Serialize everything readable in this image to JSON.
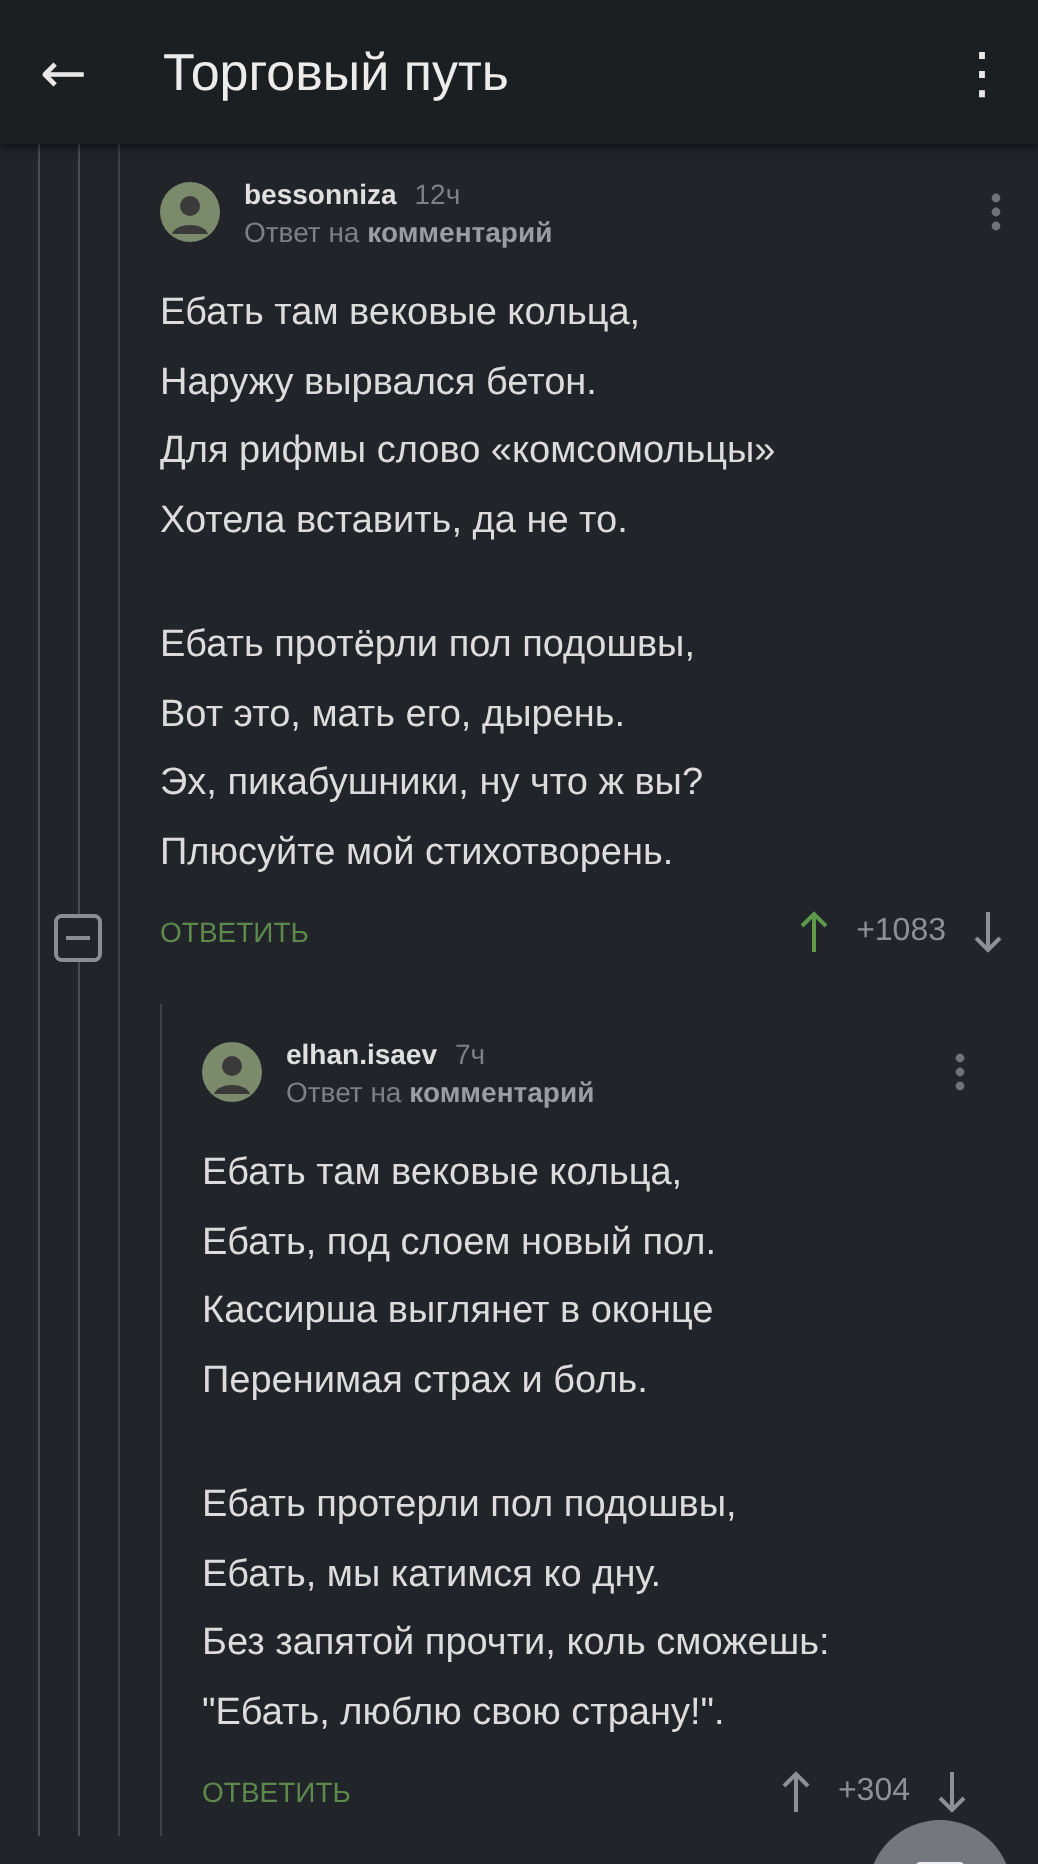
{
  "header": {
    "back": "←",
    "title": "Торговый путь",
    "menu": "⋮"
  },
  "comments": [
    {
      "author": "bessonniza",
      "time": "12ч",
      "reply_to": "Ответ на **комментарий**",
      "expanded": true,
      "stanzas": [
        [
          "Ебать там вековые кольца,",
          "Наружу вырвался бетон.",
          "Для рифмы слово «комсомольцы»",
          "Хотела вставить, да не то."
        ],
        [
          "Ебать протёрли пол подошвы,",
          "Вот это, мать его, дырень.",
          "Эх, пикабушники, ну что ж вы?",
          "Плюсуйте мой стихотворень."
        ]
      ],
      "reply": "ОТВЕТИТЬ",
      "rating": "+1083",
      "upvoted": true,
      "children": [
        {
          "author": "elhan.isaev",
          "time": "7ч",
          "reply_to": "Ответ на **комментарий**",
          "stanzas": [
            [
              "Ебать там вековые кольца,",
              "Ебать, под слоем новый пол.",
              "Кассирша выглянет в оконце",
              "Перенимая страх и боль."
            ],
            [
              "Ебать протерли пол подошвы,",
              "Ебать, мы катимся ко дну.",
              "Без запятой прочти, коль сможешь:",
              "\"Ебать, люблю свою страну!\"."
            ]
          ],
          "reply": "ОТВЕТИТЬ",
          "rating": "+304",
          "upvoted": false
        }
      ]
    }
  ]
}
